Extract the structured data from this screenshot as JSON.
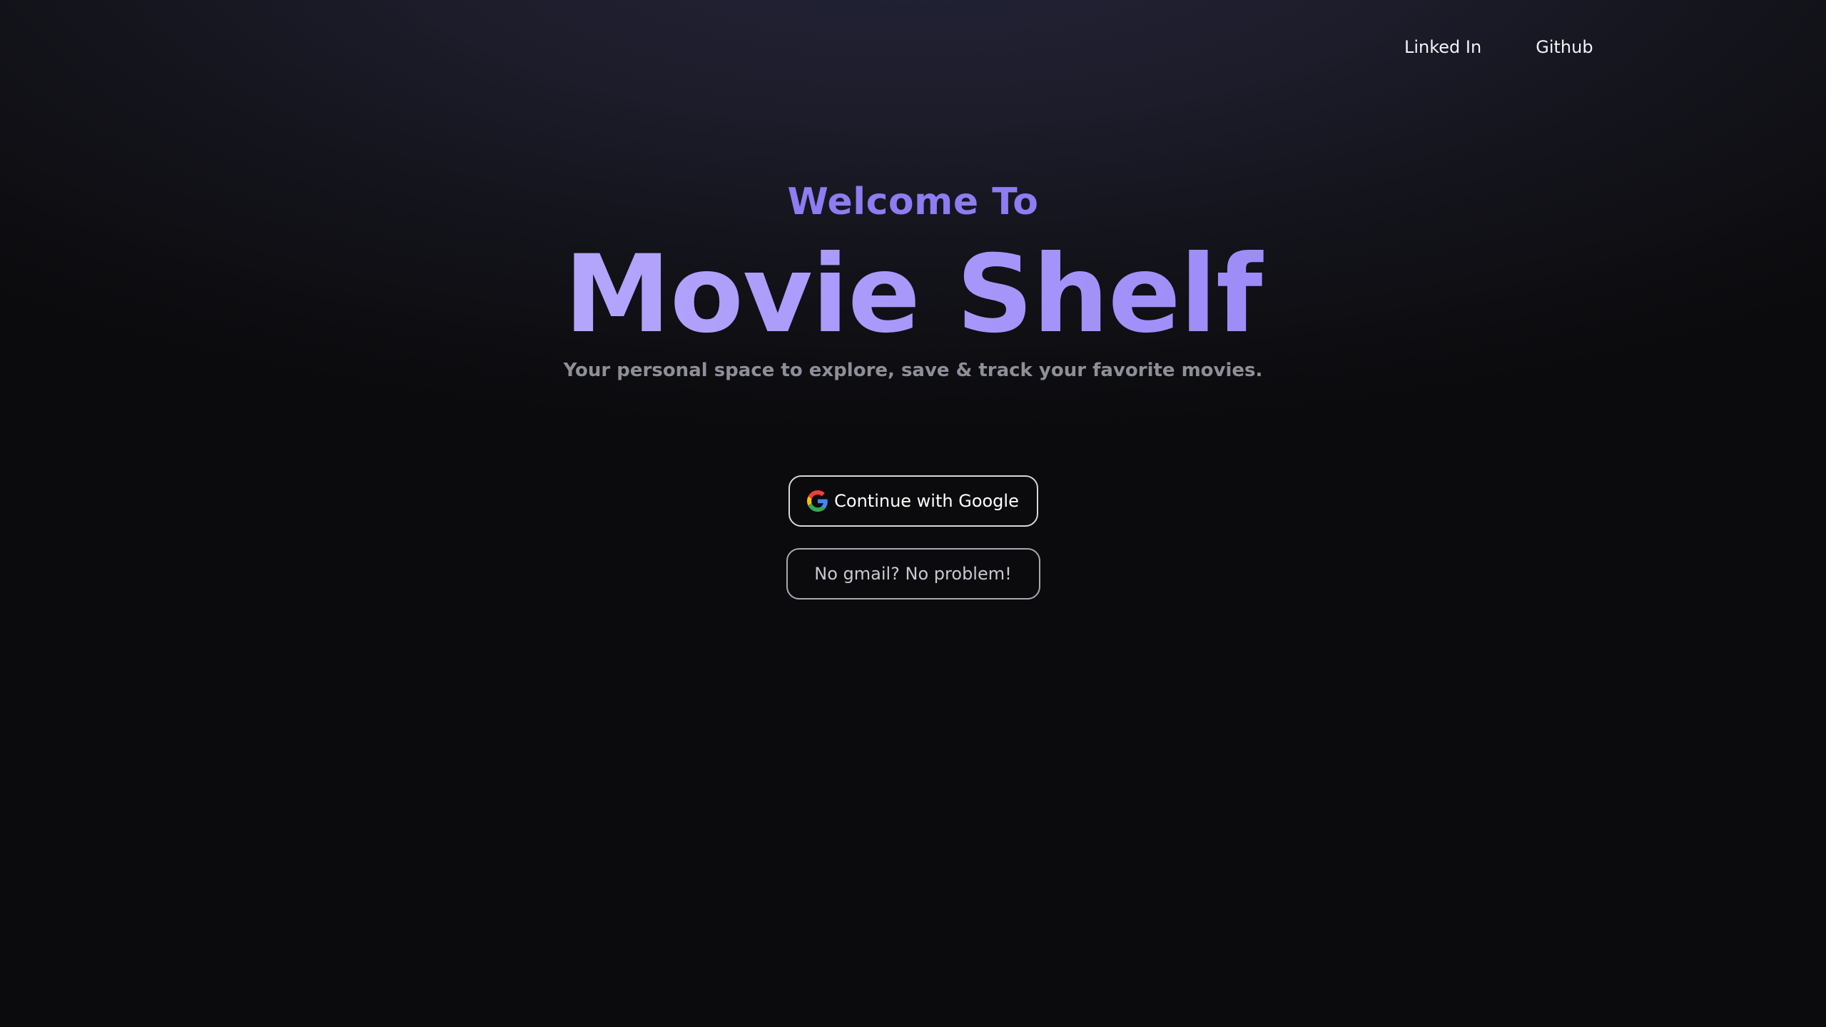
{
  "nav": {
    "links": [
      {
        "label": "Linked In"
      },
      {
        "label": "Github"
      }
    ]
  },
  "hero": {
    "welcome": "Welcome To",
    "title": "Movie Shelf",
    "subtitle": "Your personal space to explore, save & track your favorite movies."
  },
  "auth": {
    "google_label": "Continue with Google",
    "google_icon": "google-icon",
    "guest_label": "No gmail? No problem!"
  },
  "colors": {
    "accent": "#8d7cf2",
    "title_gradient_start": "#c9bdfd",
    "title_gradient_end": "#8b79f1",
    "background": "#0b0b0d"
  }
}
